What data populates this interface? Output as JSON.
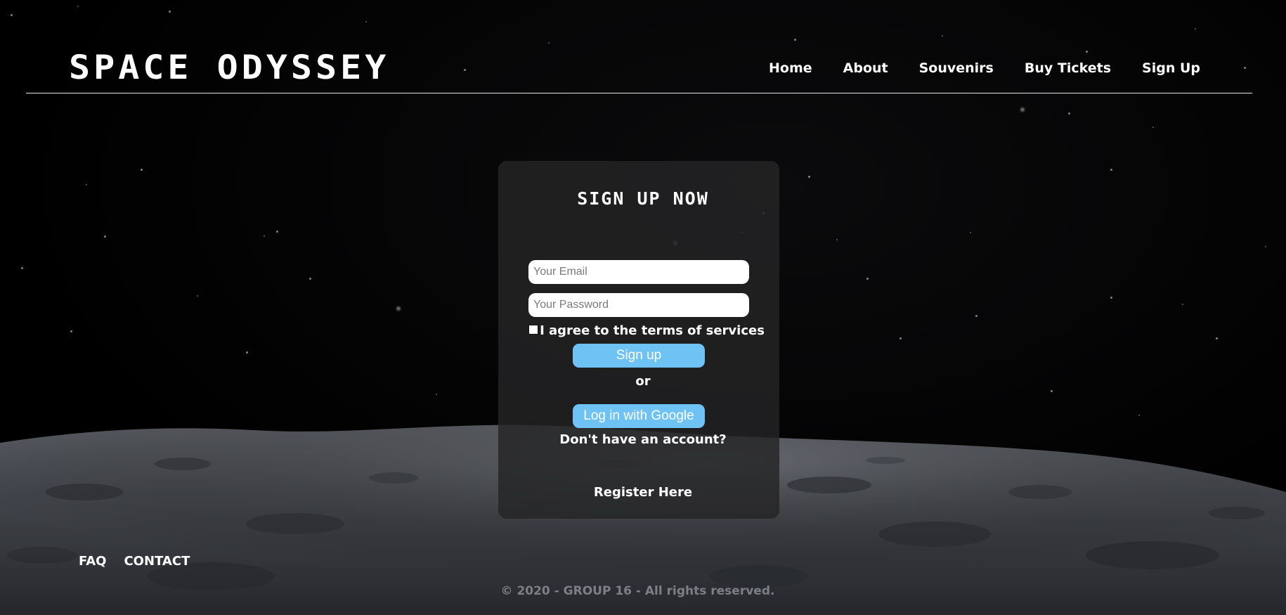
{
  "header": {
    "logo": "SPACE ODYSSEY",
    "nav": [
      "Home",
      "About",
      "Souvenirs",
      "Buy Tickets",
      "Sign Up"
    ]
  },
  "signup": {
    "title": "SIGN UP NOW",
    "email_placeholder": "Your Email",
    "password_placeholder": "Your Password",
    "terms_label": "I agree to the terms of services",
    "signup_button": "Sign up",
    "or_text": "or",
    "google_button": "Log in with Google",
    "no_account_text": "Don't have an account?",
    "register_link": "Register Here"
  },
  "footer": {
    "links": [
      "FAQ",
      "CONTACT"
    ],
    "copyright": "© 2020 - GROUP 16 - All rights reserved."
  },
  "colors": {
    "background": "#000000",
    "card": "#242426",
    "button": "#6ec3f4",
    "copyright": "#7c7f86"
  }
}
